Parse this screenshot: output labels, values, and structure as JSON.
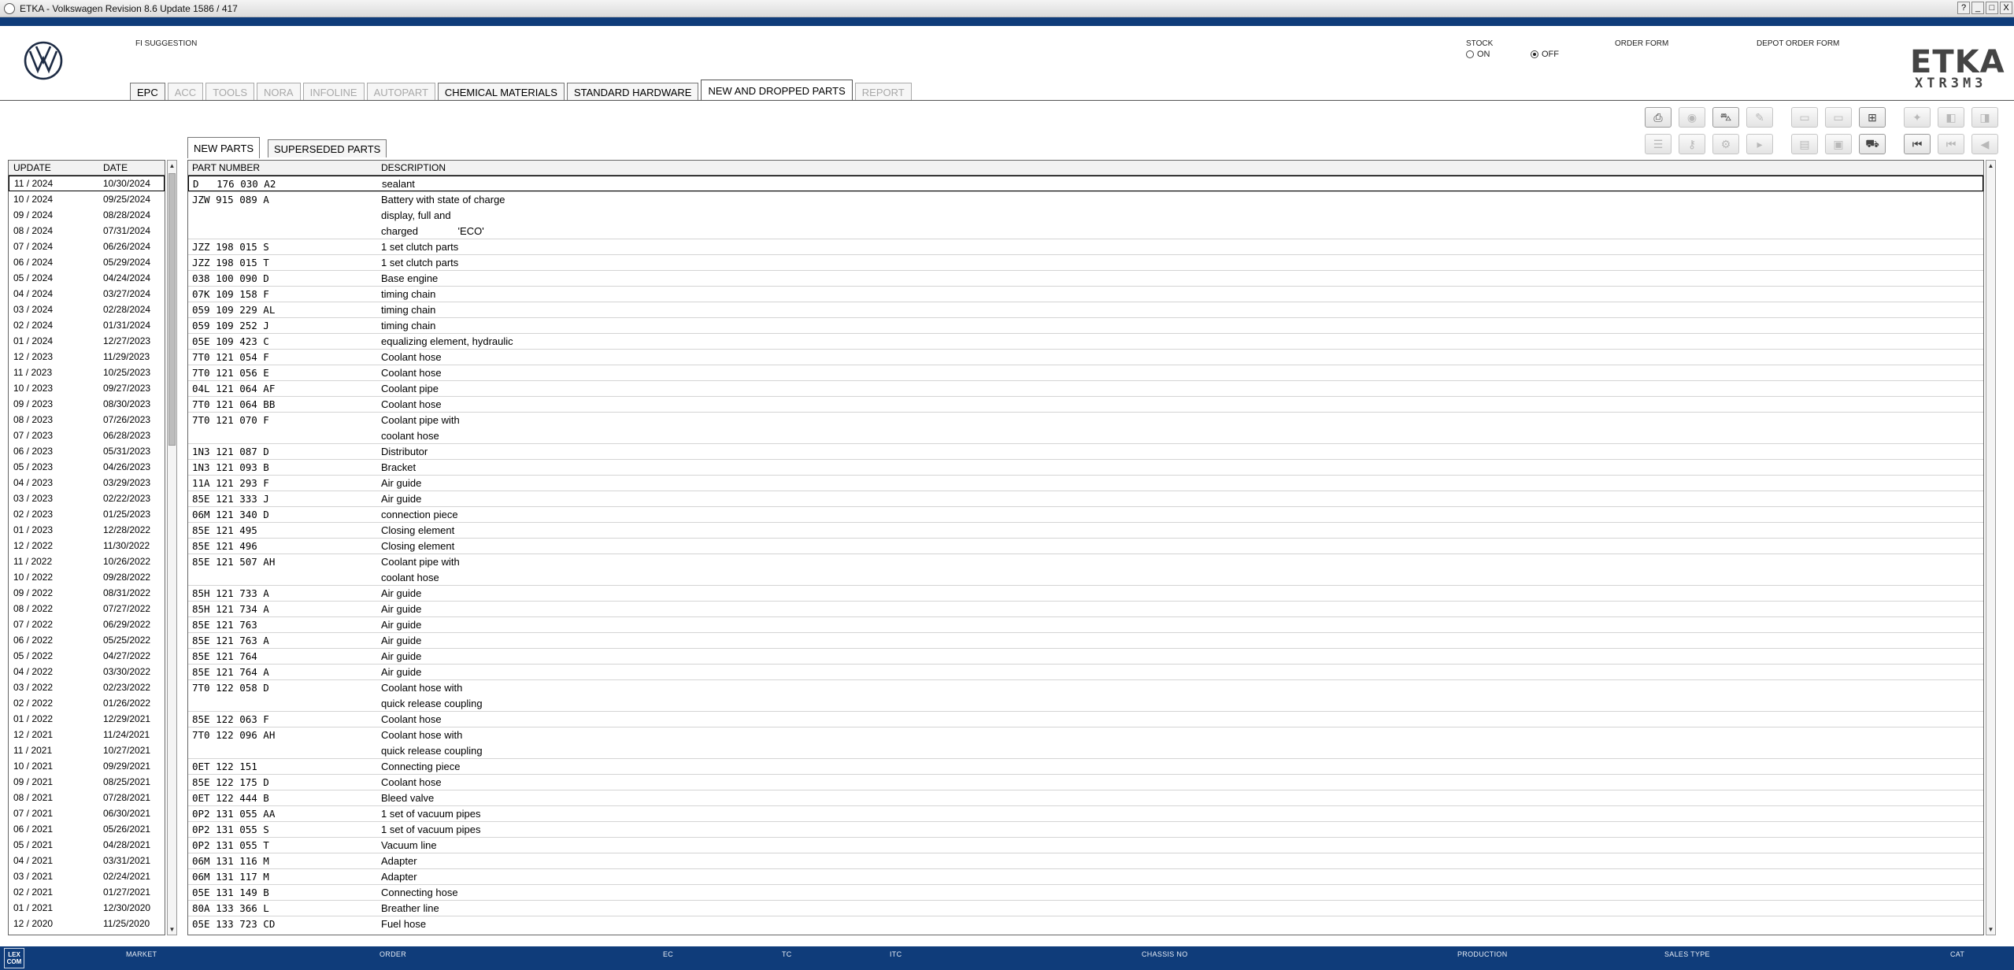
{
  "window": {
    "title": "ETKA - Volkswagen Revision 8.6 Update 1586 / 417",
    "controls": [
      "?",
      "_",
      "□",
      "X"
    ]
  },
  "header": {
    "fi_suggestion": "FI SUGGESTION",
    "stock_label": "STOCK",
    "stock_on": "ON",
    "stock_off": "OFF",
    "order_form": "ORDER FORM",
    "depot_order_form": "DEPOT ORDER FORM",
    "etka_logo": "ETKA",
    "etka_sub": "XTR3M3"
  },
  "main_tabs": [
    {
      "label": "EPC",
      "state": "enabled"
    },
    {
      "label": "ACC",
      "state": "disabled"
    },
    {
      "label": "TOOLS",
      "state": "disabled"
    },
    {
      "label": "NORA",
      "state": "disabled"
    },
    {
      "label": "INFOLINE",
      "state": "disabled"
    },
    {
      "label": "AUTOPART",
      "state": "disabled"
    },
    {
      "label": "CHEMICAL MATERIALS",
      "state": "enabled"
    },
    {
      "label": "STANDARD HARDWARE",
      "state": "enabled"
    },
    {
      "label": "NEW AND DROPPED PARTS",
      "state": "active"
    },
    {
      "label": "REPORT",
      "state": "disabled"
    }
  ],
  "toolbar": {
    "row1": [
      {
        "icon": "printer-icon",
        "glyph": "⎙",
        "enabled": true
      },
      {
        "icon": "globe-icon",
        "glyph": "◉",
        "enabled": false
      },
      {
        "icon": "car-icon",
        "glyph": "⛍",
        "enabled": true
      },
      {
        "icon": "signature-icon",
        "glyph": "✎",
        "enabled": false
      },
      {
        "icon": "monitor-icon",
        "glyph": "▭",
        "enabled": false
      },
      {
        "icon": "display-icon",
        "glyph": "▭",
        "enabled": false
      },
      {
        "icon": "cart-add-icon",
        "glyph": "⊞",
        "enabled": true
      },
      {
        "icon": "pin-icon",
        "glyph": "✦",
        "enabled": false
      },
      {
        "icon": "page-back-icon",
        "glyph": "◧",
        "enabled": false
      },
      {
        "icon": "page-forward-icon",
        "glyph": "◨",
        "enabled": false
      }
    ],
    "row2": [
      {
        "icon": "list-icon",
        "glyph": "☰",
        "enabled": false
      },
      {
        "icon": "key-icon",
        "glyph": "⚷",
        "enabled": false
      },
      {
        "icon": "engine-icon",
        "glyph": "⚙",
        "enabled": false
      },
      {
        "icon": "play-step-icon",
        "glyph": "▸",
        "enabled": false
      },
      {
        "icon": "cabinet-icon",
        "glyph": "▤",
        "enabled": false
      },
      {
        "icon": "box-icon",
        "glyph": "▣",
        "enabled": false
      },
      {
        "icon": "cart-icon",
        "glyph": "⛟",
        "enabled": true
      },
      {
        "icon": "first-page-icon",
        "glyph": "⏮",
        "enabled": true
      },
      {
        "icon": "prev-double-icon",
        "glyph": "⏮",
        "enabled": false
      },
      {
        "icon": "prev-icon",
        "glyph": "◀",
        "enabled": false
      }
    ]
  },
  "sub_tabs": [
    {
      "label": "NEW PARTS",
      "active": true
    },
    {
      "label": "SUPERSEDED PARTS",
      "active": false
    }
  ],
  "updates": {
    "headers": {
      "update": "UPDATE",
      "date": "DATE"
    },
    "rows": [
      [
        "11 / 2024",
        "10/30/2024"
      ],
      [
        "10 / 2024",
        "09/25/2024"
      ],
      [
        "09 / 2024",
        "08/28/2024"
      ],
      [
        "08 / 2024",
        "07/31/2024"
      ],
      [
        "07 / 2024",
        "06/26/2024"
      ],
      [
        "06 / 2024",
        "05/29/2024"
      ],
      [
        "05 / 2024",
        "04/24/2024"
      ],
      [
        "04 / 2024",
        "03/27/2024"
      ],
      [
        "03 / 2024",
        "02/28/2024"
      ],
      [
        "02 / 2024",
        "01/31/2024"
      ],
      [
        "01 / 2024",
        "12/27/2023"
      ],
      [
        "12 / 2023",
        "11/29/2023"
      ],
      [
        "11 / 2023",
        "10/25/2023"
      ],
      [
        "10 / 2023",
        "09/27/2023"
      ],
      [
        "09 / 2023",
        "08/30/2023"
      ],
      [
        "08 / 2023",
        "07/26/2023"
      ],
      [
        "07 / 2023",
        "06/28/2023"
      ],
      [
        "06 / 2023",
        "05/31/2023"
      ],
      [
        "05 / 2023",
        "04/26/2023"
      ],
      [
        "04 / 2023",
        "03/29/2023"
      ],
      [
        "03 / 2023",
        "02/22/2023"
      ],
      [
        "02 / 2023",
        "01/25/2023"
      ],
      [
        "01 / 2023",
        "12/28/2022"
      ],
      [
        "12 / 2022",
        "11/30/2022"
      ],
      [
        "11 / 2022",
        "10/26/2022"
      ],
      [
        "10 / 2022",
        "09/28/2022"
      ],
      [
        "09 / 2022",
        "08/31/2022"
      ],
      [
        "08 / 2022",
        "07/27/2022"
      ],
      [
        "07 / 2022",
        "06/29/2022"
      ],
      [
        "06 / 2022",
        "05/25/2022"
      ],
      [
        "05 / 2022",
        "04/27/2022"
      ],
      [
        "04 / 2022",
        "03/30/2022"
      ],
      [
        "03 / 2022",
        "02/23/2022"
      ],
      [
        "02 / 2022",
        "01/26/2022"
      ],
      [
        "01 / 2022",
        "12/29/2021"
      ],
      [
        "12 / 2021",
        "11/24/2021"
      ],
      [
        "11 / 2021",
        "10/27/2021"
      ],
      [
        "10 / 2021",
        "09/29/2021"
      ],
      [
        "09 / 2021",
        "08/25/2021"
      ],
      [
        "08 / 2021",
        "07/28/2021"
      ],
      [
        "07 / 2021",
        "06/30/2021"
      ],
      [
        "06 / 2021",
        "05/26/2021"
      ],
      [
        "05 / 2021",
        "04/28/2021"
      ],
      [
        "04 / 2021",
        "03/31/2021"
      ],
      [
        "03 / 2021",
        "02/24/2021"
      ],
      [
        "02 / 2021",
        "01/27/2021"
      ],
      [
        "01 / 2021",
        "12/30/2020"
      ],
      [
        "12 / 2020",
        "11/25/2020"
      ]
    ]
  },
  "parts": {
    "headers": {
      "part_number": "PART NUMBER",
      "description": "DESCRIPTION"
    },
    "rows": [
      {
        "pn": "D   176 030 A2",
        "desc": "sealant"
      },
      {
        "pn": "JZW 915 089 A",
        "desc": "Battery with state of charge"
      },
      {
        "pn": "",
        "desc": "display, full and"
      },
      {
        "pn": "",
        "desc": "charged              'ECO'"
      },
      {
        "pn": "JZZ 198 015 S",
        "desc": "1 set clutch parts"
      },
      {
        "pn": "JZZ 198 015 T",
        "desc": "1 set clutch parts"
      },
      {
        "pn": "038 100 090 D",
        "desc": "Base engine"
      },
      {
        "pn": "07K 109 158 F",
        "desc": "timing chain"
      },
      {
        "pn": "059 109 229 AL",
        "desc": "timing chain"
      },
      {
        "pn": "059 109 252 J",
        "desc": "timing chain"
      },
      {
        "pn": "05E 109 423 C",
        "desc": "equalizing element, hydraulic"
      },
      {
        "pn": "7T0 121 054 F",
        "desc": "Coolant hose"
      },
      {
        "pn": "7T0 121 056 E",
        "desc": "Coolant hose"
      },
      {
        "pn": "04L 121 064 AF",
        "desc": "Coolant pipe"
      },
      {
        "pn": "7T0 121 064 BB",
        "desc": "Coolant hose"
      },
      {
        "pn": "7T0 121 070 F",
        "desc": "Coolant pipe with"
      },
      {
        "pn": "",
        "desc": "coolant hose"
      },
      {
        "pn": "1N3 121 087 D",
        "desc": "Distributor"
      },
      {
        "pn": "1N3 121 093 B",
        "desc": "Bracket"
      },
      {
        "pn": "11A 121 293 F",
        "desc": "Air guide"
      },
      {
        "pn": "85E 121 333 J",
        "desc": "Air guide"
      },
      {
        "pn": "06M 121 340 D",
        "desc": "connection piece"
      },
      {
        "pn": "85E 121 495",
        "desc": "Closing element"
      },
      {
        "pn": "85E 121 496",
        "desc": "Closing element"
      },
      {
        "pn": "85E 121 507 AH",
        "desc": "Coolant pipe with"
      },
      {
        "pn": "",
        "desc": "coolant hose"
      },
      {
        "pn": "85H 121 733 A",
        "desc": "Air guide"
      },
      {
        "pn": "85H 121 734 A",
        "desc": "Air guide"
      },
      {
        "pn": "85E 121 763",
        "desc": "Air guide"
      },
      {
        "pn": "85E 121 763 A",
        "desc": "Air guide"
      },
      {
        "pn": "85E 121 764",
        "desc": "Air guide"
      },
      {
        "pn": "85E 121 764 A",
        "desc": "Air guide"
      },
      {
        "pn": "7T0 122 058 D",
        "desc": "Coolant hose with"
      },
      {
        "pn": "",
        "desc": "quick release coupling"
      },
      {
        "pn": "85E 122 063 F",
        "desc": "Coolant hose"
      },
      {
        "pn": "7T0 122 096 AH",
        "desc": "Coolant hose with"
      },
      {
        "pn": "",
        "desc": "quick release coupling"
      },
      {
        "pn": "0ET 122 151",
        "desc": "Connecting piece"
      },
      {
        "pn": "85E 122 175 D",
        "desc": "Coolant hose"
      },
      {
        "pn": "0ET 122 444 B",
        "desc": "Bleed valve"
      },
      {
        "pn": "0P2 131 055 AA",
        "desc": "1 set of vacuum pipes"
      },
      {
        "pn": "0P2 131 055 S",
        "desc": "1 set of vacuum pipes"
      },
      {
        "pn": "0P2 131 055 T",
        "desc": "Vacuum line"
      },
      {
        "pn": "06M 131 116 M",
        "desc": "Adapter"
      },
      {
        "pn": "06M 131 117 M",
        "desc": "Adapter"
      },
      {
        "pn": "05E 131 149 B",
        "desc": "Connecting hose"
      },
      {
        "pn": "80A 133 366 L",
        "desc": "Breather line"
      },
      {
        "pn": "05E 133 723 CD",
        "desc": "Fuel hose"
      }
    ]
  },
  "statusbar": {
    "logo": "LEX COM",
    "market": "MARKET",
    "order": "ORDER",
    "ec": "EC",
    "tc": "TC",
    "itc": "ITC",
    "chassis_no": "CHASSIS NO",
    "production": "PRODUCTION",
    "sales_type": "SALES TYPE",
    "cat": "CAT"
  }
}
